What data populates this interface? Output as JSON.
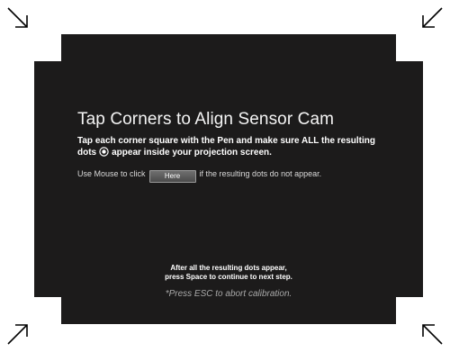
{
  "title": "Tap Corners to Align Sensor Cam",
  "instructions": {
    "line1": "Tap each corner square with the Pen and make sure ALL the resulting",
    "line2_start": "dots",
    "line2_end": "appear inside your projection screen."
  },
  "mouse_row": {
    "prefix": "Use Mouse to click",
    "button_label": "Here",
    "suffix": "if the resulting dots do not appear."
  },
  "footer": {
    "line1": "After all the resulting dots appear,",
    "line2": "press Space to continue to next step.",
    "esc_note": "*Press ESC to abort calibration."
  },
  "colors": {
    "screen_background": "#1c1b1b",
    "corner_square": "#ffffff",
    "arrow": "#000000"
  },
  "icons": {
    "corner_arrows": [
      "arrow-down-right-icon",
      "arrow-down-left-icon",
      "arrow-up-right-icon",
      "arrow-up-left-icon"
    ],
    "dot": "target-dot-icon"
  }
}
